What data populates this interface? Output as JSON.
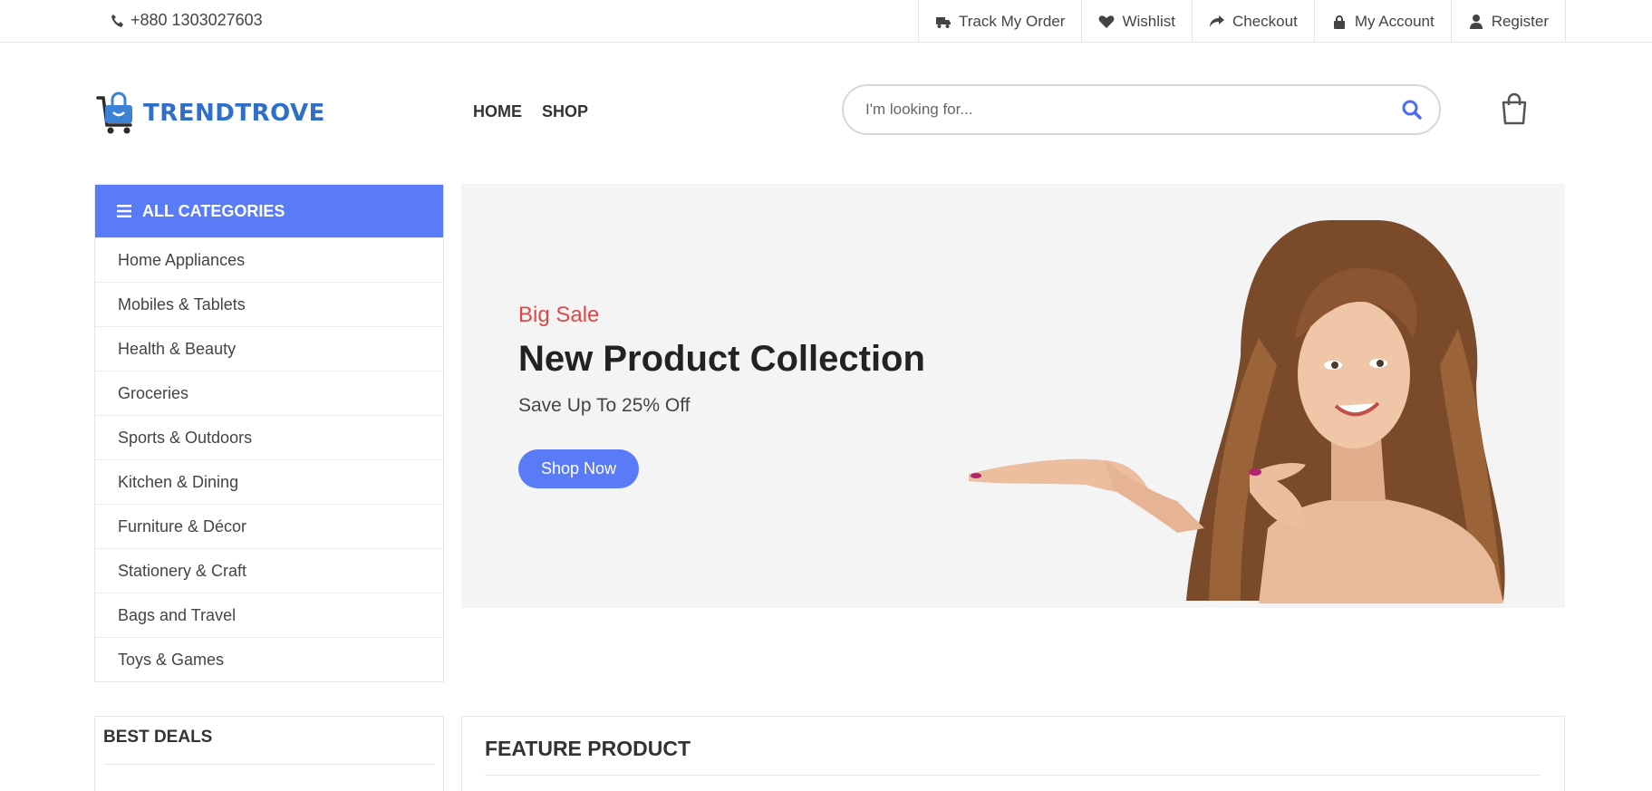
{
  "topbar": {
    "phone": "+880 1303027603",
    "links": [
      {
        "label": "Track My Order",
        "icon": "truck-icon"
      },
      {
        "label": "Wishlist",
        "icon": "heart-icon"
      },
      {
        "label": "Checkout",
        "icon": "share-arrow-icon"
      },
      {
        "label": "My Account",
        "icon": "lock-icon"
      },
      {
        "label": "Register",
        "icon": "user-icon"
      }
    ]
  },
  "header": {
    "logo_text": "TRENDTROVE",
    "nav": [
      "HOME",
      "SHOP"
    ],
    "search_placeholder": "I'm looking for..."
  },
  "categories": {
    "title": "ALL CATEGORIES",
    "items": [
      "Home Appliances",
      "Mobiles & Tablets",
      "Health & Beauty",
      "Groceries",
      "Sports & Outdoors",
      "Kitchen & Dining",
      "Furniture & Décor",
      "Stationery & Craft",
      "Bags and Travel",
      "Toys & Games"
    ]
  },
  "banner": {
    "tag": "Big Sale",
    "title": "New Product Collection",
    "subtitle": "Save Up To 25% Off",
    "button": "Shop Now"
  },
  "best_deals": {
    "title": "BEST DEALS"
  },
  "feature": {
    "title": "FEATURE PRODUCT"
  },
  "colors": {
    "accent": "#5a7bf7",
    "sale_red": "#e04848",
    "logo_blue": "#2f6fc6",
    "banner_bg": "#f4f4f4"
  }
}
